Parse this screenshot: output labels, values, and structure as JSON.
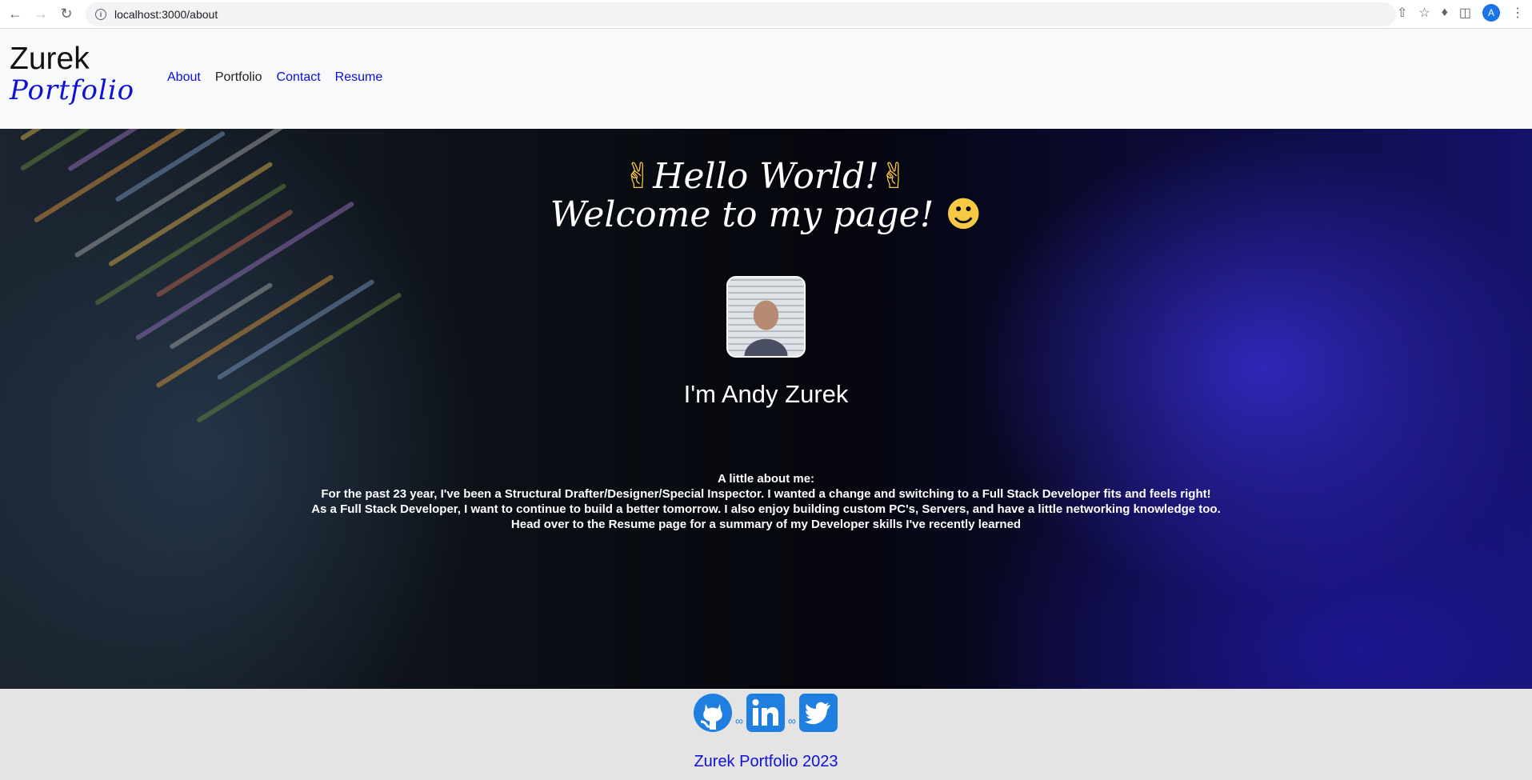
{
  "browser": {
    "url": "localhost:3000/about",
    "profile_initial": "A"
  },
  "navbar": {
    "brand_top": "Zurek",
    "brand_bottom": "Portfolio",
    "links": [
      {
        "label": "About"
      },
      {
        "label": "Portfolio"
      },
      {
        "label": "Contact"
      },
      {
        "label": "Resume"
      }
    ],
    "active_link": "Portfolio"
  },
  "hero": {
    "greeting_line1": "Hello World!",
    "greeting_line2": "Welcome to my page!",
    "name": "I'm Andy Zurek",
    "about_heading": "A little about me:",
    "about_lines": [
      "For the past 23 year, I've been a Structural Drafter/Designer/Special Inspector. I wanted a change and switching to a Full Stack Developer fits and feels right!",
      "As a Full Stack Developer, I want to continue to build a better tomorrow. I also enjoy building custom PC's, Servers, and have a little networking knowledge too.",
      "Head over to the Resume page for a summary of my Developer skills I've recently learned"
    ]
  },
  "footer": {
    "socials": [
      "github-icon",
      "linkedin-icon",
      "twitter-icon"
    ],
    "copyright": "Zurek Portfolio 2023",
    "accent_color": "#1f7fe0"
  }
}
